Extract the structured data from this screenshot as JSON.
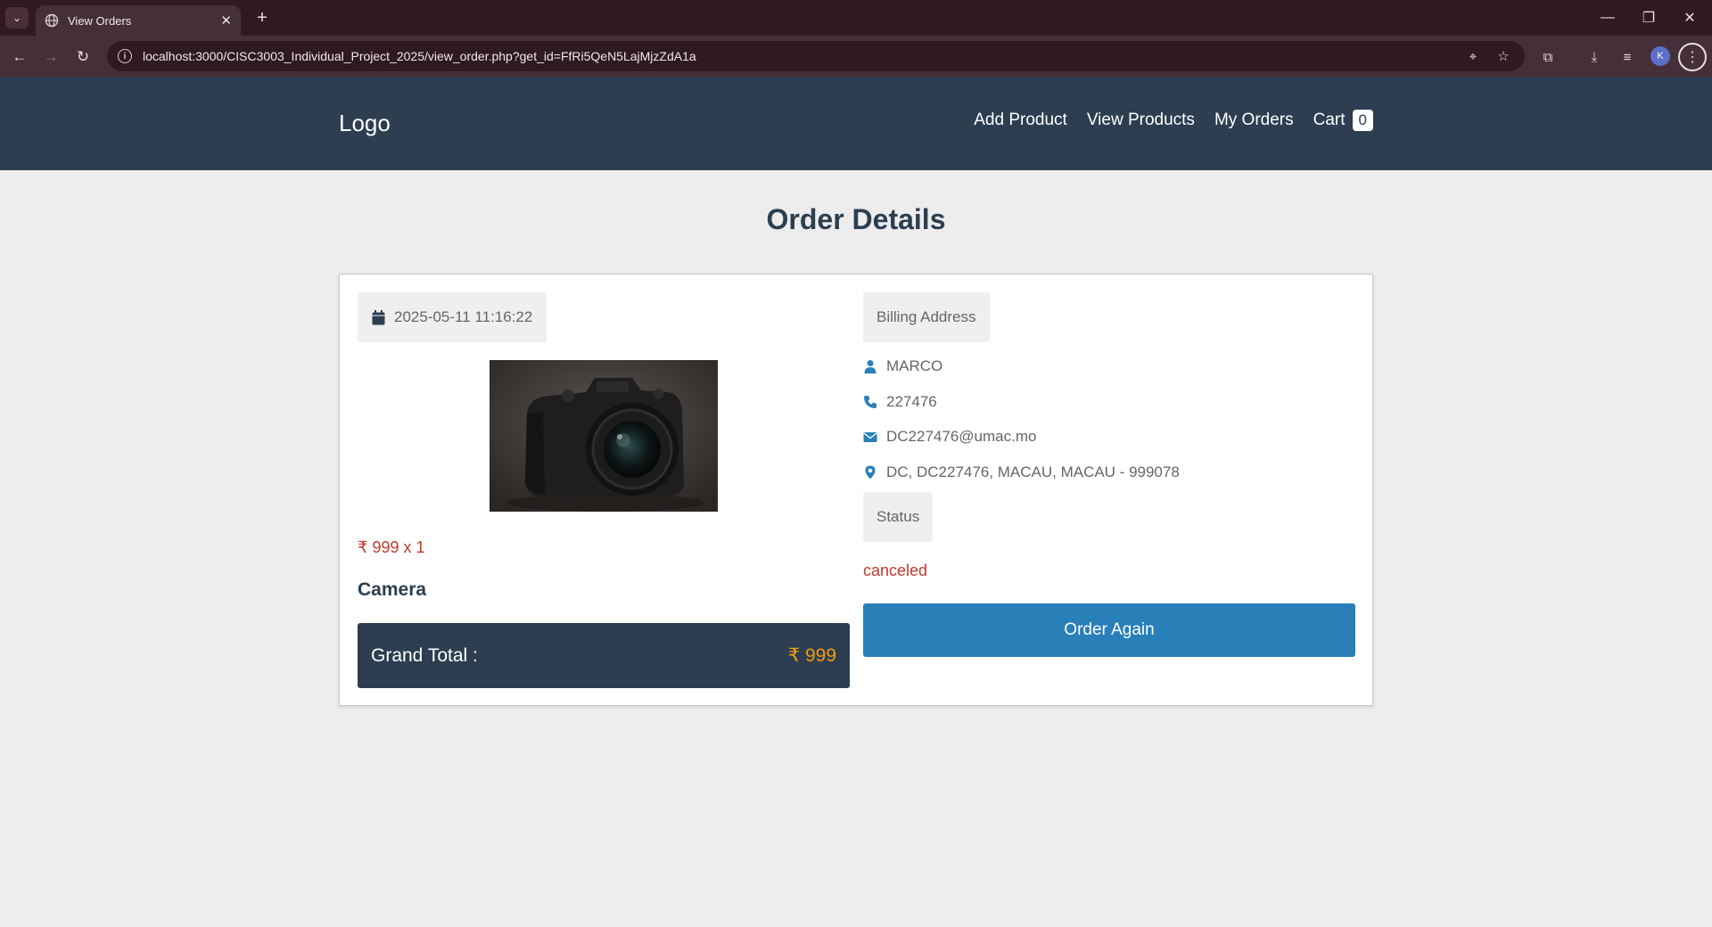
{
  "browser": {
    "tab_title": "View Orders",
    "url": "localhost:3000/CISC3003_Individual_Project_2025/view_order.php?get_id=FfRi5QeN5LajMjzZdA1a",
    "profile_initial": "K"
  },
  "header": {
    "logo": "Logo",
    "nav": {
      "add_product": "Add Product",
      "view_products": "View Products",
      "my_orders": "My Orders",
      "cart": "Cart",
      "cart_count": "0"
    }
  },
  "page": {
    "title": "Order Details"
  },
  "order": {
    "date": "2025-05-11 11:16:22",
    "price_line": "₹ 999 x 1",
    "product_name": "Camera",
    "product_image_icon": "camera-photo",
    "grand_total_label": "Grand Total :",
    "grand_total_value": "₹ 999"
  },
  "billing": {
    "section_label": "Billing Address",
    "name": "MARCO",
    "phone": "227476",
    "email": "DC227476@umac.mo",
    "address": "DC, DC227476, MACAU, MACAU - 999078",
    "status_label": "Status",
    "status_value": "canceled",
    "order_again_label": "Order Again"
  },
  "colors": {
    "header_bg": "#2c3e50",
    "accent_blue": "#2980b9",
    "status_red": "#c0392b",
    "total_orange": "#f39c12"
  }
}
